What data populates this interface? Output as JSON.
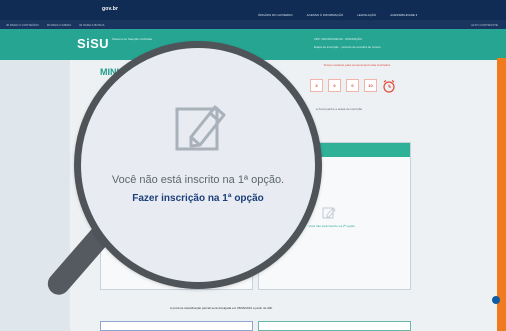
{
  "gov_bar": {
    "brand": "gov.br",
    "menu": [
      "ÓRGÃOS DO GOVERNO",
      "ACESSO À INFORMAÇÃO",
      "LEGISLAÇÃO",
      "ACESSIBILIDADE ▾"
    ]
  },
  "access_bar": {
    "links": [
      "IR PARA O CONTEÚDO",
      "IR PARA O MENU",
      "IR PARA A BUSCA"
    ],
    "right": "ALTO CONTRASTE"
  },
  "header": {
    "logo": "SiSU",
    "subtitle": "Sistema de Seleção Unificada",
    "info_lines": [
      "CPF: 000.000.000-00 · INSCRIÇÃO",
      "Etapa de inscrição · período de escolha de cursos"
    ]
  },
  "main": {
    "title": "MINHA INSCRIÇÃO",
    "countdown_text": "Tempo restante para encerramento das inscrições",
    "countdown": [
      "3",
      "0",
      "0",
      "10"
    ],
    "step_info": "● Acompanhe a etapa de inscrição"
  },
  "card_right": {
    "text": "Você não está inscrito na 2ª opção."
  },
  "bottom": {
    "note": "A próxima classificação parcial será divulgada em 05/06/2023 a partir de 00h."
  },
  "magnifier": {
    "message": "Você não está inscrito na 1ª opção.",
    "action": "Fazer inscrição na 1ª opção"
  },
  "colors": {
    "header_teal": "#26a592",
    "gov_navy": "#102c55",
    "accent_orange": "#f07a1e",
    "link_navy": "#1c3f7a"
  },
  "icons": {
    "edit": "edit-icon",
    "alarm": "alarm-clock-icon",
    "chat": "chat-icon"
  }
}
